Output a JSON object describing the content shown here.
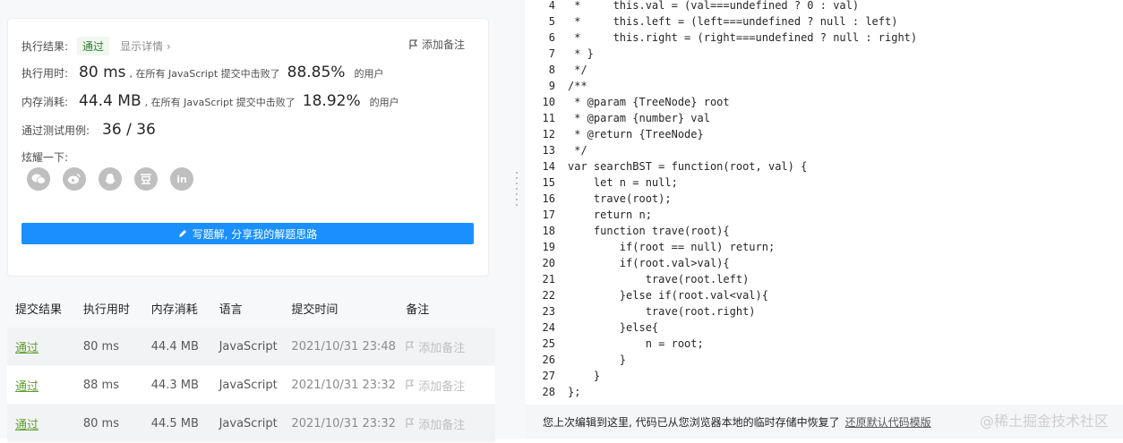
{
  "result": {
    "status_label": "执行结果:",
    "status_value": "通过",
    "detail_link": "显示详情 ›",
    "add_note": "添加备注",
    "time_label": "执行用时:",
    "time_value": "80 ms",
    "time_mid": ", 在所有 JavaScript 提交中击败了",
    "time_pct": "88.85%",
    "time_suffix": "的用户",
    "mem_label": "内存消耗:",
    "mem_value": "44.4 MB",
    "mem_mid": ", 在所有 JavaScript 提交中击败了",
    "mem_pct": "18.92%",
    "mem_suffix": "的用户",
    "tests_label": "通过测试用例:",
    "tests_value": "36 / 36",
    "share_label": "炫耀一下:",
    "share_icons": [
      "wechat-icon",
      "weibo-icon",
      "qq-icon",
      "douban-icon",
      "linkedin-icon"
    ],
    "write_button": "写题解, 分享我的解题思路"
  },
  "submissions": {
    "headers": [
      "提交结果",
      "执行用时",
      "内存消耗",
      "语言",
      "提交时间",
      "备注"
    ],
    "rows": [
      {
        "status": "通过",
        "time": "80 ms",
        "memory": "44.4 MB",
        "lang": "JavaScript",
        "submitted": "2021/10/31 23:48",
        "note": "添加备注"
      },
      {
        "status": "通过",
        "time": "88 ms",
        "memory": "44.3 MB",
        "lang": "JavaScript",
        "submitted": "2021/10/31 23:32",
        "note": "添加备注"
      },
      {
        "status": "通过",
        "time": "80 ms",
        "memory": "44.5 MB",
        "lang": "JavaScript",
        "submitted": "2021/10/31 23:32",
        "note": "添加备注"
      }
    ]
  },
  "code": [
    {
      "n": "4",
      "t": " *     this.val = (val===undefined ? 0 : val)"
    },
    {
      "n": "5",
      "t": " *     this.left = (left===undefined ? null : left)"
    },
    {
      "n": "6",
      "t": " *     this.right = (right===undefined ? null : right)"
    },
    {
      "n": "7",
      "t": " * }"
    },
    {
      "n": "8",
      "t": " */"
    },
    {
      "n": "9",
      "t": "/**"
    },
    {
      "n": "10",
      "t": " * @param {TreeNode} root"
    },
    {
      "n": "11",
      "t": " * @param {number} val"
    },
    {
      "n": "12",
      "t": " * @return {TreeNode}"
    },
    {
      "n": "13",
      "t": " */"
    },
    {
      "n": "14",
      "t": "var searchBST = function(root, val) {"
    },
    {
      "n": "15",
      "t": "    let n = null;"
    },
    {
      "n": "16",
      "t": "    trave(root);"
    },
    {
      "n": "17",
      "t": "    return n;"
    },
    {
      "n": "18",
      "t": "    function trave(root){"
    },
    {
      "n": "19",
      "t": "        if(root == null) return;"
    },
    {
      "n": "20",
      "t": "        if(root.val>val){"
    },
    {
      "n": "21",
      "t": "            trave(root.left)"
    },
    {
      "n": "22",
      "t": "        }else if(root.val<val){"
    },
    {
      "n": "23",
      "t": "            trave(root.right)"
    },
    {
      "n": "24",
      "t": "        }else{"
    },
    {
      "n": "25",
      "t": "            n = root;"
    },
    {
      "n": "26",
      "t": "        }"
    },
    {
      "n": "27",
      "t": "    }"
    },
    {
      "n": "28",
      "t": "};"
    }
  ],
  "footer": {
    "message": "您上次编辑到这里, 代码已从您浏览器本地的临时存储中恢复了",
    "restore_link": "还原默认代码模版",
    "watermark": "@稀土掘金技术社区"
  }
}
